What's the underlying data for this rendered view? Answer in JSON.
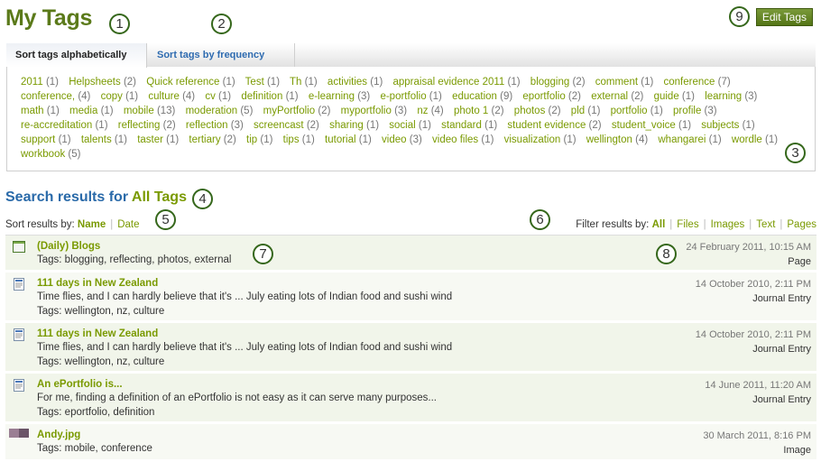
{
  "page": {
    "title": "My Tags",
    "edit_button": "Edit Tags"
  },
  "tabs": [
    {
      "label": "Sort tags alphabetically",
      "active": true
    },
    {
      "label": "Sort tags by frequency",
      "active": false
    }
  ],
  "tags": [
    {
      "name": "2011",
      "count": "(1)"
    },
    {
      "name": "Helpsheets",
      "count": "(2)"
    },
    {
      "name": "Quick reference",
      "count": "(1)"
    },
    {
      "name": "Test",
      "count": "(1)"
    },
    {
      "name": "Th",
      "count": "(1)"
    },
    {
      "name": "activities",
      "count": "(1)"
    },
    {
      "name": "appraisal evidence 2011",
      "count": "(1)"
    },
    {
      "name": "blogging",
      "count": "(2)"
    },
    {
      "name": "comment",
      "count": "(1)"
    },
    {
      "name": "conference",
      "count": "(7)"
    },
    {
      "name": "conference,",
      "count": "(4)"
    },
    {
      "name": "copy",
      "count": "(1)"
    },
    {
      "name": "culture",
      "count": "(4)"
    },
    {
      "name": "cv",
      "count": "(1)"
    },
    {
      "name": "definition",
      "count": "(1)"
    },
    {
      "name": "e-learning",
      "count": "(3)"
    },
    {
      "name": "e-portfolio",
      "count": "(1)"
    },
    {
      "name": "education",
      "count": "(9)"
    },
    {
      "name": "eportfolio",
      "count": "(2)"
    },
    {
      "name": "external",
      "count": "(2)"
    },
    {
      "name": "guide",
      "count": "(1)"
    },
    {
      "name": "learning",
      "count": "(3)"
    },
    {
      "name": "math",
      "count": "(1)"
    },
    {
      "name": "media",
      "count": "(1)"
    },
    {
      "name": "mobile",
      "count": "(13)"
    },
    {
      "name": "moderation",
      "count": "(5)"
    },
    {
      "name": "myPortfolio",
      "count": "(2)"
    },
    {
      "name": "myportfolio",
      "count": "(3)"
    },
    {
      "name": "nz",
      "count": "(4)"
    },
    {
      "name": "photo 1",
      "count": "(2)"
    },
    {
      "name": "photos",
      "count": "(2)"
    },
    {
      "name": "pld",
      "count": "(1)"
    },
    {
      "name": "portfolio",
      "count": "(1)"
    },
    {
      "name": "profile",
      "count": "(3)"
    },
    {
      "name": "re-accreditation",
      "count": "(1)"
    },
    {
      "name": "reflecting",
      "count": "(2)"
    },
    {
      "name": "reflection",
      "count": "(3)"
    },
    {
      "name": "screencast",
      "count": "(2)"
    },
    {
      "name": "sharing",
      "count": "(1)"
    },
    {
      "name": "social",
      "count": "(1)"
    },
    {
      "name": "standard",
      "count": "(1)"
    },
    {
      "name": "student evidence",
      "count": "(2)"
    },
    {
      "name": "student_voice",
      "count": "(1)"
    },
    {
      "name": "subjects",
      "count": "(1)"
    },
    {
      "name": "support",
      "count": "(1)"
    },
    {
      "name": "talents",
      "count": "(1)"
    },
    {
      "name": "taster",
      "count": "(1)"
    },
    {
      "name": "tertiary",
      "count": "(2)"
    },
    {
      "name": "tip",
      "count": "(1)"
    },
    {
      "name": "tips",
      "count": "(1)"
    },
    {
      "name": "tutorial",
      "count": "(1)"
    },
    {
      "name": "video",
      "count": "(3)"
    },
    {
      "name": "video files",
      "count": "(1)"
    },
    {
      "name": "visualization",
      "count": "(1)"
    },
    {
      "name": "wellington",
      "count": "(4)"
    },
    {
      "name": "whangarei",
      "count": "(1)"
    },
    {
      "name": "wordle",
      "count": "(1)"
    },
    {
      "name": "workbook",
      "count": "(5)"
    }
  ],
  "search": {
    "heading_prefix": "Search results for",
    "heading_highlight": "All Tags",
    "sort_label": "Sort results by:",
    "sort_options": [
      {
        "label": "Name",
        "selected": true
      },
      {
        "label": "Date",
        "selected": false
      }
    ],
    "filter_label": "Filter results by:",
    "filter_options": [
      {
        "label": "All",
        "selected": true
      },
      {
        "label": "Files",
        "selected": false
      },
      {
        "label": "Images",
        "selected": false
      },
      {
        "label": "Text",
        "selected": false
      },
      {
        "label": "Pages",
        "selected": false
      }
    ]
  },
  "results": [
    {
      "icon": "page-icon",
      "title": "(Daily) Blogs",
      "description": "",
      "tags": "Tags: blogging, reflecting, photos, external",
      "date": "24 February 2011, 10:15 AM",
      "type": "Page"
    },
    {
      "icon": "journal-entry-icon",
      "title": "111 days in New Zealand",
      "description": "Time flies, and I can hardly believe that it's ... July eating lots of Indian food and sushi wind",
      "tags": "Tags: wellington, nz, culture",
      "date": "14 October 2010, 2:11 PM",
      "type": "Journal Entry"
    },
    {
      "icon": "journal-entry-icon",
      "title": "111 days in New Zealand",
      "description": "Time flies, and I can hardly believe that it's ... July eating lots of Indian food and sushi wind",
      "tags": "Tags: wellington, nz, culture",
      "date": "14 October 2010, 2:11 PM",
      "type": "Journal Entry"
    },
    {
      "icon": "journal-entry-icon",
      "title": "An ePortfolio is...",
      "description": "For me, finding a definition of an ePortfolio is not easy as it can serve many purposes...",
      "tags": "Tags: eportfolio, definition",
      "date": "14 June 2011, 11:20 AM",
      "type": "Journal Entry"
    },
    {
      "icon": "image-thumbnail-icon",
      "title": "Andy.jpg",
      "description": "",
      "tags": "Tags: mobile, conference",
      "date": "30 March 2011, 8:16 PM",
      "type": "Image"
    }
  ],
  "callouts": [
    "1",
    "2",
    "3",
    "4",
    "5",
    "6",
    "7",
    "8",
    "9"
  ],
  "colors": {
    "accent_green": "#7a9a01",
    "title_green": "#5b7a1a",
    "link_blue": "#2a6aa9",
    "row_bg": "#f1f5ea"
  }
}
